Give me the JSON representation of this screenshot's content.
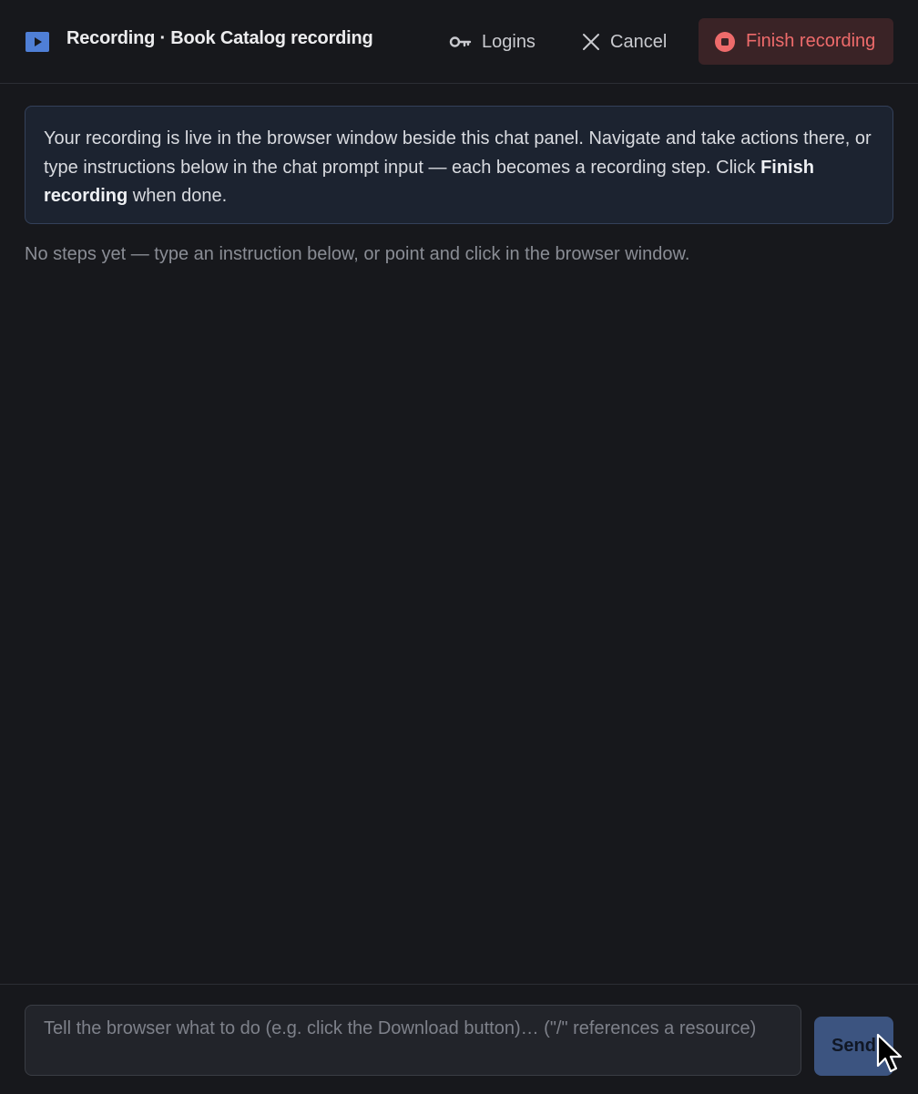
{
  "header": {
    "title": "Recording · Book Catalog recording",
    "logins_label": "Logins",
    "cancel_label": "Cancel",
    "finish_label": "Finish recording"
  },
  "info": {
    "text_before": "Your recording is live in the browser window beside this chat panel. Navigate and take actions there, or type instructions below in the chat prompt input — each becomes a recording step. Click ",
    "bold": "Finish recording",
    "text_after": " when done."
  },
  "steps": {
    "empty_text": "No steps yet — type an instruction below, or point and click in the browser window."
  },
  "composer": {
    "placeholder": "Tell the browser what to do (e.g. click the Download button)… (\"/\" references a resource)",
    "value": "",
    "send_label": "Send"
  },
  "icons": {
    "recording": "play-square-icon",
    "logins": "key-icon",
    "cancel": "close-icon",
    "finish": "stop-circle-icon",
    "cursor": "mouse-pointer-icon"
  },
  "colors": {
    "background": "#17181c",
    "accent": "#4f7fd6",
    "danger": "#ee6b6b",
    "danger_bg": "#3a2326",
    "info_bg": "#1c2330",
    "send_bg": "#3c5480"
  }
}
